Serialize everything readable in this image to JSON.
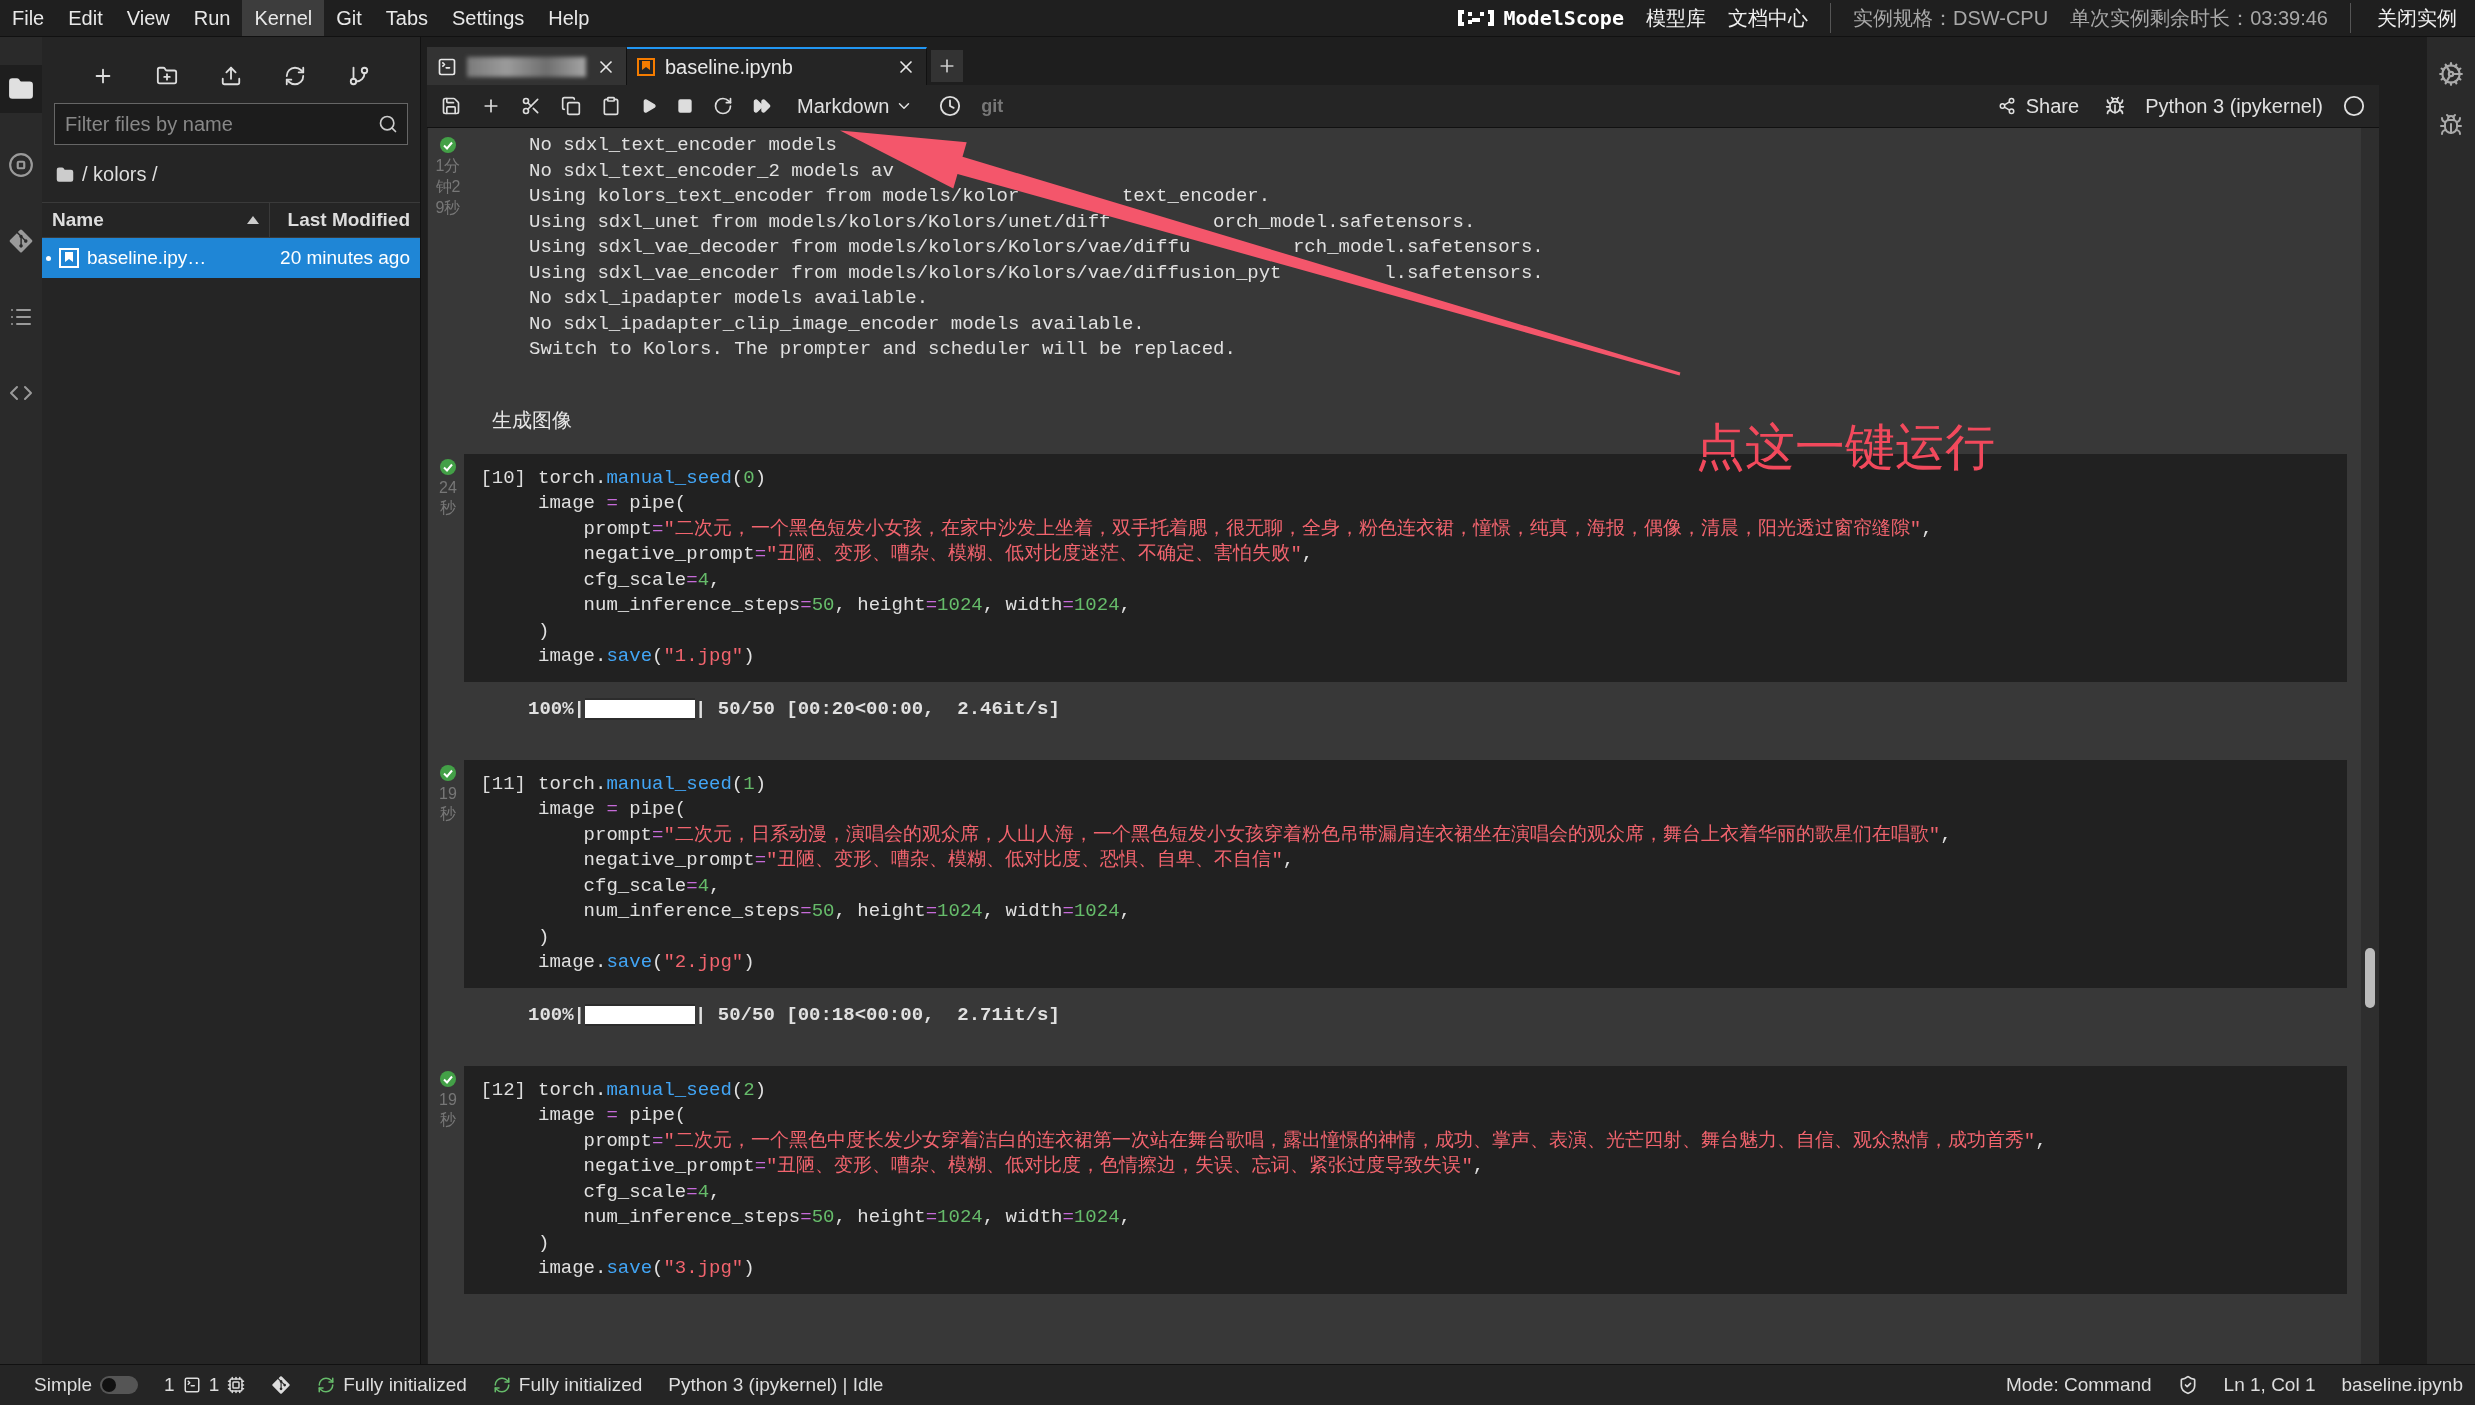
{
  "menu": [
    {
      "label": "File",
      "selected": false
    },
    {
      "label": "Edit",
      "selected": false
    },
    {
      "label": "View",
      "selected": false
    },
    {
      "label": "Run",
      "selected": false
    },
    {
      "label": "Kernel",
      "selected": true
    },
    {
      "label": "Git",
      "selected": false
    },
    {
      "label": "Tabs",
      "selected": false
    },
    {
      "label": "Settings",
      "selected": false
    },
    {
      "label": "Help",
      "selected": false
    }
  ],
  "header_right": {
    "logo_text": "ModelScope",
    "links": [
      "模型库",
      "文档中心"
    ],
    "instance_spec": "实例规格：DSW-CPU",
    "remaining_time": "单次实例剩余时长：03:39:46",
    "close_button": "关闭实例"
  },
  "left_sidebar": [
    {
      "kind": "folder",
      "selected": true
    },
    {
      "kind": "running",
      "selected": false
    },
    {
      "kind": "git",
      "selected": false
    },
    {
      "kind": "toc",
      "selected": false
    },
    {
      "kind": "code",
      "selected": false
    }
  ],
  "file_browser": {
    "filter": {
      "placeholder": "Filter files by name"
    },
    "path": "/ kolors /",
    "columns": [
      {
        "label": "Name",
        "sorted": true
      },
      {
        "label": "Last Modified",
        "sorted": false
      }
    ],
    "files": [
      {
        "name": "baseline.ipy…",
        "modified": "20 minutes ago",
        "selected": true,
        "running": true
      }
    ]
  },
  "tabs": [
    {
      "kind": "terminal",
      "selected": false
    },
    {
      "kind": "notebook",
      "label": "baseline.ipynb",
      "selected": true
    }
  ],
  "toolbar": {
    "cell_type": "Markdown",
    "git": "git",
    "share": "Share",
    "kernel": "Python 3 (ipykernel)",
    "kernel_busy": false
  },
  "cells": [
    {
      "kind": "output",
      "time": "1分钟29秒",
      "lines": [
        [
          "No sdxl_text_encoder models"
        ],
        [
          "No sdxl_text_encoder_2 models av"
        ],
        [
          "Using kolors_text_encoder from models/kolor",
          "text_encoder."
        ],
        [
          "Using sdxl_unet from models/kolors/Kolors/unet/diff",
          "orch_model.safetensors."
        ],
        [
          "Using sdxl_vae_decoder from models/kolors/Kolors/vae/diffu",
          "rch_model.safetensors."
        ],
        [
          "Using sdxl_vae_encoder from models/kolors/Kolors/vae/diffusion_pyt",
          "l.safetensors."
        ],
        [
          "No sdxl_ipadapter models available."
        ],
        [
          "No sdxl_ipadapter_clip_image_encoder models available."
        ],
        [
          "Switch to Kolors. The prompter and scheduler will be replaced."
        ]
      ]
    },
    {
      "kind": "markdown",
      "text": "生成图像"
    },
    {
      "kind": "code",
      "prompt": "[10]",
      "time": "24秒",
      "lines": [
        [
          {
            "kind": "plain",
            "text": "torch."
          },
          {
            "kind": "call",
            "text": "manual_seed"
          },
          {
            "kind": "plain",
            "text": "("
          },
          {
            "kind": "number",
            "text": "0"
          },
          {
            "kind": "plain",
            "text": ")"
          }
        ],
        [
          {
            "kind": "plain",
            "text": "image "
          },
          {
            "kind": "operator",
            "text": "="
          },
          {
            "kind": "plain",
            "text": " pipe("
          }
        ],
        [
          {
            "kind": "plain",
            "text": "    prompt"
          },
          {
            "kind": "operator",
            "text": "="
          },
          {
            "kind": "string",
            "text": "\"二次元，一个黑色短发小女孩，在家中沙发上坐着，双手托着腮，很无聊，全身，粉色连衣裙，憧憬，纯真，海报，偶像，清晨，阳光透过窗帘缝隙\""
          },
          {
            "kind": "plain",
            "text": ","
          }
        ],
        [
          {
            "kind": "plain",
            "text": "    negative_prompt"
          },
          {
            "kind": "operator",
            "text": "="
          },
          {
            "kind": "string",
            "text": "\"丑陋、变形、嘈杂、模糊、低对比度迷茫、不确定、害怕失败\""
          },
          {
            "kind": "plain",
            "text": ","
          }
        ],
        [
          {
            "kind": "plain",
            "text": "    cfg_scale"
          },
          {
            "kind": "operator",
            "text": "="
          },
          {
            "kind": "number",
            "text": "4"
          },
          {
            "kind": "plain",
            "text": ","
          }
        ],
        [
          {
            "kind": "plain",
            "text": "    num_inference_steps"
          },
          {
            "kind": "operator",
            "text": "="
          },
          {
            "kind": "number",
            "text": "50"
          },
          {
            "kind": "plain",
            "text": ", height"
          },
          {
            "kind": "operator",
            "text": "="
          },
          {
            "kind": "number",
            "text": "1024"
          },
          {
            "kind": "plain",
            "text": ", width"
          },
          {
            "kind": "operator",
            "text": "="
          },
          {
            "kind": "number",
            "text": "1024"
          },
          {
            "kind": "plain",
            "text": ","
          }
        ],
        [
          {
            "kind": "plain",
            "text": ")"
          }
        ],
        [
          {
            "kind": "plain",
            "text": "image."
          },
          {
            "kind": "call",
            "text": "save"
          },
          {
            "kind": "plain",
            "text": "("
          },
          {
            "kind": "string",
            "text": "\"1.jpg\""
          },
          {
            "kind": "plain",
            "text": ")"
          }
        ]
      ],
      "progress": {
        "percent": "100%|",
        "level": 1,
        "stats": "| 50/50 [00:20<00:00,  2.46it/s]"
      }
    },
    {
      "kind": "code",
      "prompt": "[11]",
      "time": "19秒",
      "lines": [
        [
          {
            "kind": "plain",
            "text": "torch."
          },
          {
            "kind": "call",
            "text": "manual_seed"
          },
          {
            "kind": "plain",
            "text": "("
          },
          {
            "kind": "number",
            "text": "1"
          },
          {
            "kind": "plain",
            "text": ")"
          }
        ],
        [
          {
            "kind": "plain",
            "text": "image "
          },
          {
            "kind": "operator",
            "text": "="
          },
          {
            "kind": "plain",
            "text": " pipe("
          }
        ],
        [
          {
            "kind": "plain",
            "text": "    prompt"
          },
          {
            "kind": "operator",
            "text": "="
          },
          {
            "kind": "string",
            "text": "\"二次元，日系动漫，演唱会的观众席，人山人海，一个黑色短发小女孩穿着粉色吊带漏肩连衣裙坐在演唱会的观众席，舞台上衣着华丽的歌星们在唱歌\""
          },
          {
            "kind": "plain",
            "text": ","
          }
        ],
        [
          {
            "kind": "plain",
            "text": "    negative_prompt"
          },
          {
            "kind": "operator",
            "text": "="
          },
          {
            "kind": "string",
            "text": "\"丑陋、变形、嘈杂、模糊、低对比度、恐惧、自卑、不自信\""
          },
          {
            "kind": "plain",
            "text": ","
          }
        ],
        [
          {
            "kind": "plain",
            "text": "    cfg_scale"
          },
          {
            "kind": "operator",
            "text": "="
          },
          {
            "kind": "number",
            "text": "4"
          },
          {
            "kind": "plain",
            "text": ","
          }
        ],
        [
          {
            "kind": "plain",
            "text": "    num_inference_steps"
          },
          {
            "kind": "operator",
            "text": "="
          },
          {
            "kind": "number",
            "text": "50"
          },
          {
            "kind": "plain",
            "text": ", height"
          },
          {
            "kind": "operator",
            "text": "="
          },
          {
            "kind": "number",
            "text": "1024"
          },
          {
            "kind": "plain",
            "text": ", width"
          },
          {
            "kind": "operator",
            "text": "="
          },
          {
            "kind": "number",
            "text": "1024"
          },
          {
            "kind": "plain",
            "text": ","
          }
        ],
        [
          {
            "kind": "plain",
            "text": ")"
          }
        ],
        [
          {
            "kind": "plain",
            "text": "image."
          },
          {
            "kind": "call",
            "text": "save"
          },
          {
            "kind": "plain",
            "text": "("
          },
          {
            "kind": "string",
            "text": "\"2.jpg\""
          },
          {
            "kind": "plain",
            "text": ")"
          }
        ]
      ],
      "progress": {
        "percent": "100%|",
        "level": 1,
        "stats": "| 50/50 [00:18<00:00,  2.71it/s]"
      }
    },
    {
      "kind": "code",
      "prompt": "[12]",
      "time": "19秒",
      "lines": [
        [
          {
            "kind": "plain",
            "text": "torch."
          },
          {
            "kind": "call",
            "text": "manual_seed"
          },
          {
            "kind": "plain",
            "text": "("
          },
          {
            "kind": "number",
            "text": "2"
          },
          {
            "kind": "plain",
            "text": ")"
          }
        ],
        [
          {
            "kind": "plain",
            "text": "image "
          },
          {
            "kind": "operator",
            "text": "="
          },
          {
            "kind": "plain",
            "text": " pipe("
          }
        ],
        [
          {
            "kind": "plain",
            "text": "    prompt"
          },
          {
            "kind": "operator",
            "text": "="
          },
          {
            "kind": "string",
            "text": "\"二次元，一个黑色中度长发少女穿着洁白的连衣裙第一次站在舞台歌唱，露出憧憬的神情，成功、掌声、表演、光芒四射、舞台魅力、自信、观众热情，成功首秀\""
          },
          {
            "kind": "plain",
            "text": ","
          }
        ],
        [
          {
            "kind": "plain",
            "text": "    negative_prompt"
          },
          {
            "kind": "operator",
            "text": "="
          },
          {
            "kind": "string",
            "text": "\"丑陋、变形、嘈杂、模糊、低对比度，色情擦边，失误、忘词、紧张过度导致失误\""
          },
          {
            "kind": "plain",
            "text": ","
          }
        ],
        [
          {
            "kind": "plain",
            "text": "    cfg_scale"
          },
          {
            "kind": "operator",
            "text": "="
          },
          {
            "kind": "number",
            "text": "4"
          },
          {
            "kind": "plain",
            "text": ","
          }
        ],
        [
          {
            "kind": "plain",
            "text": "    num_inference_steps"
          },
          {
            "kind": "operator",
            "text": "="
          },
          {
            "kind": "number",
            "text": "50"
          },
          {
            "kind": "plain",
            "text": ", height"
          },
          {
            "kind": "operator",
            "text": "="
          },
          {
            "kind": "number",
            "text": "1024"
          },
          {
            "kind": "plain",
            "text": ", width"
          },
          {
            "kind": "operator",
            "text": "="
          },
          {
            "kind": "number",
            "text": "1024"
          },
          {
            "kind": "plain",
            "text": ","
          }
        ],
        [
          {
            "kind": "plain",
            "text": ")"
          }
        ],
        [
          {
            "kind": "plain",
            "text": "image."
          },
          {
            "kind": "call",
            "text": "save"
          },
          {
            "kind": "plain",
            "text": "("
          },
          {
            "kind": "string",
            "text": "\"3.jpg\""
          },
          {
            "kind": "plain",
            "text": ")"
          }
        ]
      ]
    }
  ],
  "annotation": {
    "text": "点这一键运行"
  },
  "status_bar": {
    "simple_mode": false,
    "simple_label": "Simple",
    "terminals": "1",
    "kernels": "1",
    "extensions": [
      "Fully initialized",
      "Fully initialized"
    ],
    "kernel_status": "Python 3 (ipykernel) | Idle",
    "mode": "Mode: Command",
    "cursor": "Ln 1, Col 1",
    "file": "baseline.ipynb"
  }
}
